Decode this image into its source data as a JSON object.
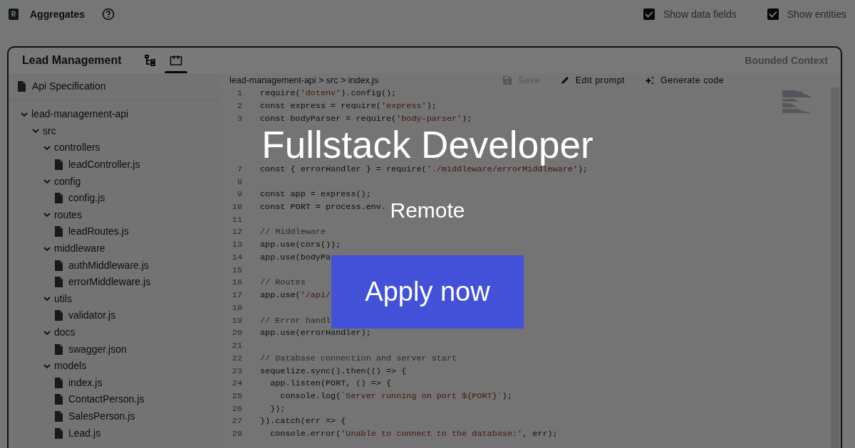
{
  "app_bar": {
    "title": "Aggregates",
    "options": [
      {
        "label": "Show data fields",
        "checked": true
      },
      {
        "label": "Show entities",
        "checked": true
      }
    ]
  },
  "context": {
    "title": "Lead Management",
    "label": "Bounded Context",
    "view_tabs": [
      {
        "kind": "tree",
        "selected": false
      },
      {
        "kind": "code",
        "selected": true
      }
    ]
  },
  "sidebar": {
    "spec_item": "Api Specification",
    "tree": [
      {
        "label": "lead-management-api",
        "kind": "folder",
        "expanded": true,
        "children": [
          {
            "label": "src",
            "kind": "folder",
            "expanded": true,
            "children": [
              {
                "label": "controllers",
                "kind": "folder",
                "expanded": true,
                "children": [
                  {
                    "label": "leadController.js",
                    "kind": "file"
                  }
                ]
              },
              {
                "label": "config",
                "kind": "folder",
                "expanded": true,
                "children": [
                  {
                    "label": "config.js",
                    "kind": "file"
                  }
                ]
              },
              {
                "label": "routes",
                "kind": "folder",
                "expanded": true,
                "children": [
                  {
                    "label": "leadRoutes.js",
                    "kind": "file"
                  }
                ]
              },
              {
                "label": "middleware",
                "kind": "folder",
                "expanded": true,
                "children": [
                  {
                    "label": "authMiddleware.js",
                    "kind": "file"
                  },
                  {
                    "label": "errorMiddleware.js",
                    "kind": "file"
                  }
                ]
              },
              {
                "label": "utils",
                "kind": "folder",
                "expanded": true,
                "children": [
                  {
                    "label": "validator.js",
                    "kind": "file"
                  }
                ]
              },
              {
                "label": "docs",
                "kind": "folder",
                "expanded": true,
                "children": [
                  {
                    "label": "swagger.json",
                    "kind": "file"
                  }
                ]
              },
              {
                "label": "models",
                "kind": "folder",
                "expanded": true,
                "children": [
                  {
                    "label": "index.js",
                    "kind": "file"
                  },
                  {
                    "label": "ContactPerson.js",
                    "kind": "file"
                  },
                  {
                    "label": "SalesPerson.js",
                    "kind": "file"
                  },
                  {
                    "label": "Lead.js",
                    "kind": "file"
                  }
                ]
              }
            ]
          }
        ]
      }
    ]
  },
  "editor": {
    "breadcrumb": "lead-management-api > src > index.js",
    "actions": [
      {
        "label": "Save",
        "kind": "save",
        "disabled": true
      },
      {
        "label": "Edit prompt",
        "kind": "edit",
        "disabled": false
      },
      {
        "label": "Generate code",
        "kind": "generate",
        "disabled": false
      }
    ],
    "lines": [
      {
        "number": "1",
        "code": "require('dotenv').config();"
      },
      {
        "number": "2",
        "code": "const express = require('express');"
      },
      {
        "number": "3",
        "code": "const bodyParser = require('body-parser');"
      },
      {
        "number": "7",
        "code": "const { errorHandler } = require('./middleware/errorMiddleware');"
      },
      {
        "number": "8"
      },
      {
        "number": "9",
        "code": "const app = express();"
      },
      {
        "number": "10",
        "code": "const PORT = process.env."
      },
      {
        "number": "11"
      },
      {
        "number": "12",
        "code": "// Middleware"
      },
      {
        "number": "13",
        "code": "app.use(cors());"
      },
      {
        "number": "14",
        "code": "app.use(bodyPa"
      },
      {
        "number": "15"
      },
      {
        "number": "16",
        "code": "// Routes"
      },
      {
        "number": "17",
        "code": "app.use('/api/"
      },
      {
        "number": "18"
      },
      {
        "number": "19",
        "code": "// Error handl"
      },
      {
        "number": "20",
        "code": "app.use(errorHandler);"
      },
      {
        "number": "21"
      },
      {
        "number": "22",
        "code": "// Database connection and server start"
      },
      {
        "number": "23",
        "code": "sequelize.sync().then(() => {"
      },
      {
        "number": "24",
        "code": "  app.listen(PORT, () => {"
      },
      {
        "number": "25",
        "code": "    console.log(`Server running on port ${PORT}`);"
      },
      {
        "number": "26",
        "code": "  });"
      },
      {
        "number": "27",
        "code": "}).catch(err => {"
      },
      {
        "number": "28",
        "code": "  console.error('Unable to connect to the database:', err);"
      }
    ]
  },
  "job_ad": {
    "title": "Fullstack Developer",
    "location": "Remote",
    "button": "Apply now"
  }
}
